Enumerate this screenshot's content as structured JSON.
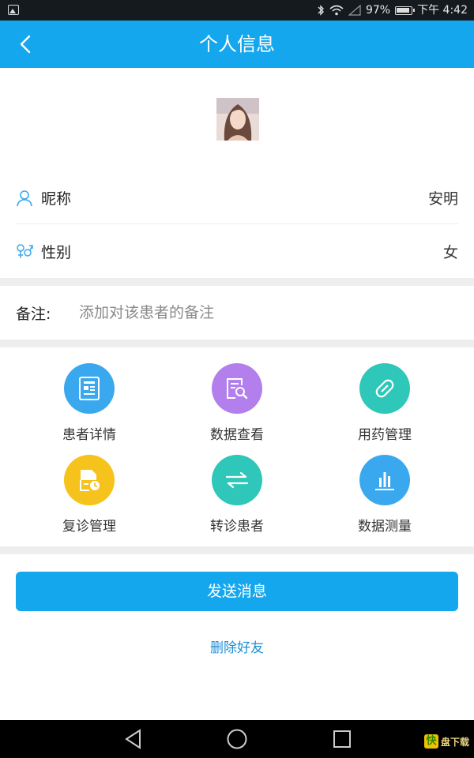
{
  "status_bar": {
    "battery_percent": "97%",
    "time": "下午 4:42"
  },
  "header": {
    "title": "个人信息"
  },
  "profile": {
    "nickname_label": "昵称",
    "nickname_value": "安明",
    "gender_label": "性别",
    "gender_value": "女"
  },
  "remark": {
    "label": "备注:",
    "placeholder": "添加对该患者的备注"
  },
  "actions": [
    {
      "label": "患者详情",
      "icon": "document-icon",
      "color": "#3aa8ef"
    },
    {
      "label": "数据查看",
      "icon": "search-document-icon",
      "color": "#b27fec"
    },
    {
      "label": "用药管理",
      "icon": "pill-icon",
      "color": "#2fc7b9"
    },
    {
      "label": "复诊管理",
      "icon": "file-clock-icon",
      "color": "#f6c21c"
    },
    {
      "label": "转诊患者",
      "icon": "transfer-arrows-icon",
      "color": "#2fc7b9"
    },
    {
      "label": "数据测量",
      "icon": "bar-chart-icon",
      "color": "#3aa8ef"
    }
  ],
  "buttons": {
    "send_message": "发送消息",
    "delete_friend": "删除好友"
  },
  "watermark": {
    "badge": "快",
    "text": "盘下载"
  },
  "colors": {
    "accent": "#14a7ee",
    "link": "#1a8fd6",
    "divider": "#eeeeee"
  }
}
